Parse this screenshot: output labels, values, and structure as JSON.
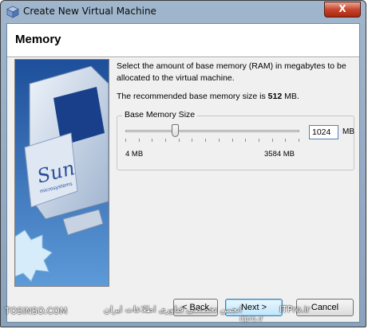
{
  "window": {
    "title": "Create New Virtual Machine",
    "close_label": "X"
  },
  "header": {
    "title": "Memory"
  },
  "content": {
    "description": "Select the amount of base memory (RAM) in megabytes to be allocated to the virtual machine.",
    "recommended_prefix": "The recommended base memory size is ",
    "recommended_value": "512",
    "recommended_suffix": " MB."
  },
  "memory": {
    "group_label": "Base Memory Size",
    "value": "1024",
    "unit": "MB",
    "min_label": "4 MB",
    "max_label": "3584 MB",
    "slider_min": 4,
    "slider_max": 3584,
    "slider_value": 1024
  },
  "buttons": {
    "back": "< Back",
    "next": "Next >",
    "cancel": "Cancel"
  },
  "art": {
    "brand": "Sun",
    "sub": "microsystems"
  },
  "watermarks": {
    "left": "TOSINSO.COM",
    "center": "انجمن تخصصی فناوری اطلاعات ایران",
    "right": "ITPro.ir",
    "bottom": "itpro.ir"
  }
}
